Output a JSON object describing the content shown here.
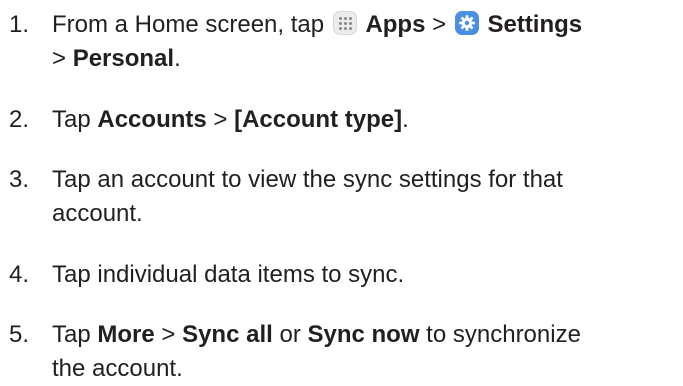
{
  "steps": [
    {
      "number": "1.",
      "line1_pre": "From a Home screen, tap ",
      "apps_label": "Apps",
      "sep1": " > ",
      "settings_label": "Settings",
      "line2_pre": "> ",
      "personal_label": "Personal",
      "line2_post": "."
    },
    {
      "number": "2.",
      "pre": "Tap ",
      "accounts_label": "Accounts",
      "sep": " > ",
      "account_type_label": "[Account type]",
      "post": "."
    },
    {
      "number": "3.",
      "line1": "Tap an account to view the sync settings for that",
      "line2": "account."
    },
    {
      "number": "4.",
      "line1": "Tap individual data items to sync."
    },
    {
      "number": "5.",
      "pre": "Tap ",
      "more_label": "More",
      "sep": " > ",
      "sync_all_label": "Sync all",
      "or": " or ",
      "sync_now_label": "Sync now",
      "post": " to synchronize",
      "line2": "the account."
    }
  ],
  "icons": {
    "apps": "apps-grid-icon",
    "settings": "settings-gear-icon",
    "settings_color": "#4a8fe0"
  }
}
